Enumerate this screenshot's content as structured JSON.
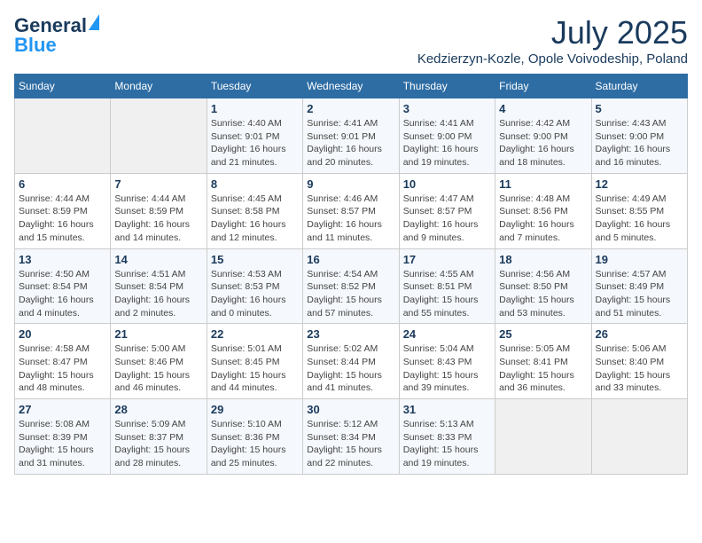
{
  "header": {
    "logo_general": "General",
    "logo_blue": "Blue",
    "month_year": "July 2025",
    "location": "Kedzierzyn-Kozle, Opole Voivodeship, Poland"
  },
  "days_of_week": [
    "Sunday",
    "Monday",
    "Tuesday",
    "Wednesday",
    "Thursday",
    "Friday",
    "Saturday"
  ],
  "weeks": [
    [
      {
        "day": "",
        "info": ""
      },
      {
        "day": "",
        "info": ""
      },
      {
        "day": "1",
        "info": "Sunrise: 4:40 AM\nSunset: 9:01 PM\nDaylight: 16 hours and 21 minutes."
      },
      {
        "day": "2",
        "info": "Sunrise: 4:41 AM\nSunset: 9:01 PM\nDaylight: 16 hours and 20 minutes."
      },
      {
        "day": "3",
        "info": "Sunrise: 4:41 AM\nSunset: 9:00 PM\nDaylight: 16 hours and 19 minutes."
      },
      {
        "day": "4",
        "info": "Sunrise: 4:42 AM\nSunset: 9:00 PM\nDaylight: 16 hours and 18 minutes."
      },
      {
        "day": "5",
        "info": "Sunrise: 4:43 AM\nSunset: 9:00 PM\nDaylight: 16 hours and 16 minutes."
      }
    ],
    [
      {
        "day": "6",
        "info": "Sunrise: 4:44 AM\nSunset: 8:59 PM\nDaylight: 16 hours and 15 minutes."
      },
      {
        "day": "7",
        "info": "Sunrise: 4:44 AM\nSunset: 8:59 PM\nDaylight: 16 hours and 14 minutes."
      },
      {
        "day": "8",
        "info": "Sunrise: 4:45 AM\nSunset: 8:58 PM\nDaylight: 16 hours and 12 minutes."
      },
      {
        "day": "9",
        "info": "Sunrise: 4:46 AM\nSunset: 8:57 PM\nDaylight: 16 hours and 11 minutes."
      },
      {
        "day": "10",
        "info": "Sunrise: 4:47 AM\nSunset: 8:57 PM\nDaylight: 16 hours and 9 minutes."
      },
      {
        "day": "11",
        "info": "Sunrise: 4:48 AM\nSunset: 8:56 PM\nDaylight: 16 hours and 7 minutes."
      },
      {
        "day": "12",
        "info": "Sunrise: 4:49 AM\nSunset: 8:55 PM\nDaylight: 16 hours and 5 minutes."
      }
    ],
    [
      {
        "day": "13",
        "info": "Sunrise: 4:50 AM\nSunset: 8:54 PM\nDaylight: 16 hours and 4 minutes."
      },
      {
        "day": "14",
        "info": "Sunrise: 4:51 AM\nSunset: 8:54 PM\nDaylight: 16 hours and 2 minutes."
      },
      {
        "day": "15",
        "info": "Sunrise: 4:53 AM\nSunset: 8:53 PM\nDaylight: 16 hours and 0 minutes."
      },
      {
        "day": "16",
        "info": "Sunrise: 4:54 AM\nSunset: 8:52 PM\nDaylight: 15 hours and 57 minutes."
      },
      {
        "day": "17",
        "info": "Sunrise: 4:55 AM\nSunset: 8:51 PM\nDaylight: 15 hours and 55 minutes."
      },
      {
        "day": "18",
        "info": "Sunrise: 4:56 AM\nSunset: 8:50 PM\nDaylight: 15 hours and 53 minutes."
      },
      {
        "day": "19",
        "info": "Sunrise: 4:57 AM\nSunset: 8:49 PM\nDaylight: 15 hours and 51 minutes."
      }
    ],
    [
      {
        "day": "20",
        "info": "Sunrise: 4:58 AM\nSunset: 8:47 PM\nDaylight: 15 hours and 48 minutes."
      },
      {
        "day": "21",
        "info": "Sunrise: 5:00 AM\nSunset: 8:46 PM\nDaylight: 15 hours and 46 minutes."
      },
      {
        "day": "22",
        "info": "Sunrise: 5:01 AM\nSunset: 8:45 PM\nDaylight: 15 hours and 44 minutes."
      },
      {
        "day": "23",
        "info": "Sunrise: 5:02 AM\nSunset: 8:44 PM\nDaylight: 15 hours and 41 minutes."
      },
      {
        "day": "24",
        "info": "Sunrise: 5:04 AM\nSunset: 8:43 PM\nDaylight: 15 hours and 39 minutes."
      },
      {
        "day": "25",
        "info": "Sunrise: 5:05 AM\nSunset: 8:41 PM\nDaylight: 15 hours and 36 minutes."
      },
      {
        "day": "26",
        "info": "Sunrise: 5:06 AM\nSunset: 8:40 PM\nDaylight: 15 hours and 33 minutes."
      }
    ],
    [
      {
        "day": "27",
        "info": "Sunrise: 5:08 AM\nSunset: 8:39 PM\nDaylight: 15 hours and 31 minutes."
      },
      {
        "day": "28",
        "info": "Sunrise: 5:09 AM\nSunset: 8:37 PM\nDaylight: 15 hours and 28 minutes."
      },
      {
        "day": "29",
        "info": "Sunrise: 5:10 AM\nSunset: 8:36 PM\nDaylight: 15 hours and 25 minutes."
      },
      {
        "day": "30",
        "info": "Sunrise: 5:12 AM\nSunset: 8:34 PM\nDaylight: 15 hours and 22 minutes."
      },
      {
        "day": "31",
        "info": "Sunrise: 5:13 AM\nSunset: 8:33 PM\nDaylight: 15 hours and 19 minutes."
      },
      {
        "day": "",
        "info": ""
      },
      {
        "day": "",
        "info": ""
      }
    ]
  ]
}
